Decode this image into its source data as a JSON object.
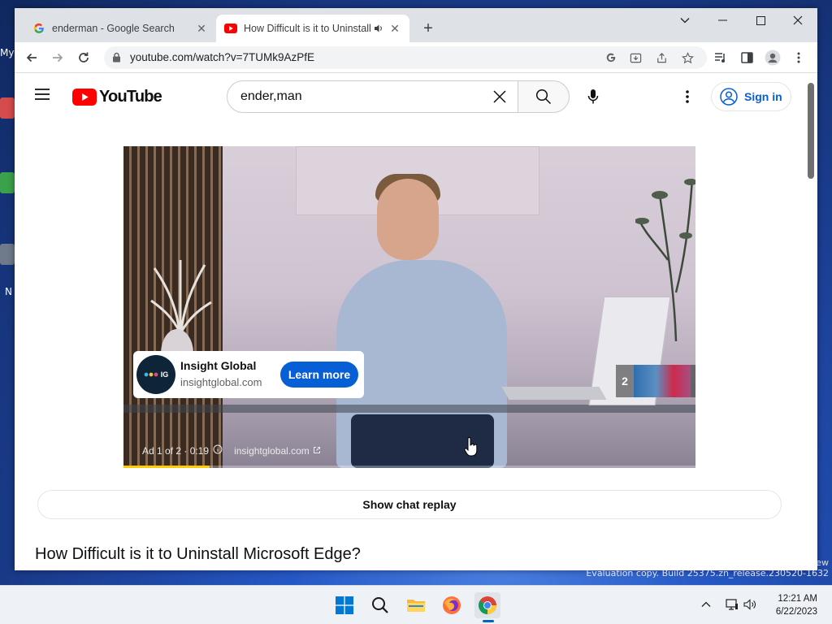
{
  "desktop": {
    "left_fragment_1": "My",
    "left_fragment_2": "N",
    "watermark_line1": "ew",
    "watermark_line2": "Evaluation copy. Build 25375.zn_release.230520-1632"
  },
  "browser": {
    "tabs": [
      {
        "title": "enderman - Google Search",
        "favicon": "google-g-icon",
        "active": false
      },
      {
        "title": "How Difficult is it to Uninstall",
        "favicon": "youtube-icon",
        "active": true,
        "audio": true
      }
    ],
    "address": "youtube.com/watch?v=7TUMk9AzPfE"
  },
  "youtube": {
    "logo_text": "YouTube",
    "search_value": "ender,man",
    "signin_label": "Sign in",
    "ad": {
      "advertiser": "Insight Global",
      "logo_text": "IG",
      "domain": "insightglobal.com",
      "cta": "Learn more",
      "meta_position": "Ad 1 of 2 · 0:19",
      "meta_domain": "insightglobal.com",
      "next_count": "2",
      "progress": 0.15
    },
    "show_chat_replay": "Show chat replay",
    "video_title": "How Difficult is it to Uninstall Microsoft Edge?"
  },
  "taskbar": {
    "apps": [
      "start-icon",
      "search-icon",
      "file-explorer-icon",
      "firefox-icon",
      "chrome-icon"
    ],
    "time": "12:21 AM",
    "date": "6/22/2023"
  },
  "colors": {
    "youtube_red": "#ff0000",
    "link_blue": "#065fd4",
    "ad_progress": "#ffcc00"
  }
}
